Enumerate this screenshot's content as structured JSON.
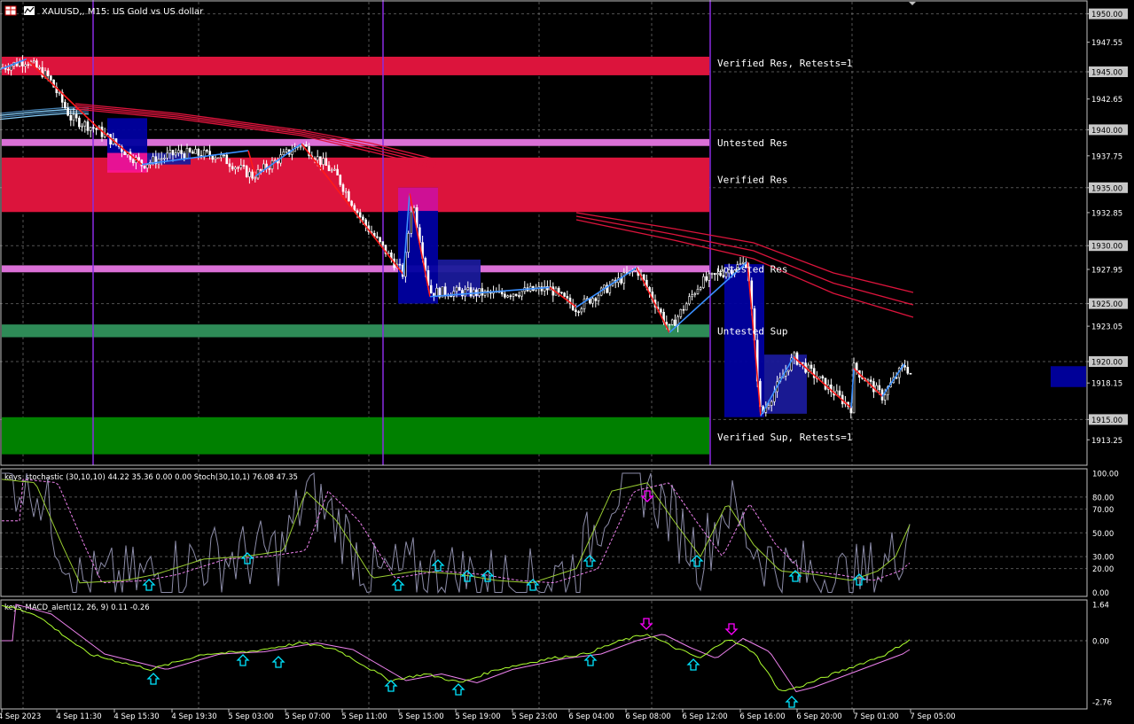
{
  "window": {
    "title": "XAUUSD,, M15: US Gold vs US dollar",
    "toolbar_icons": [
      "table-icon",
      "chart-icon"
    ]
  },
  "price_axis": {
    "labels": [
      "1950.00",
      "1947.55",
      "1945.00",
      "1942.65",
      "1940.00",
      "1937.75",
      "1935.00",
      "1932.85",
      "1930.00",
      "1927.95",
      "1925.00",
      "1923.05",
      "1920.00",
      "1918.15",
      "1915.00",
      "1913.25"
    ],
    "boxed": [
      "1950.00",
      "1945.00",
      "1940.00",
      "1935.00",
      "1930.00",
      "1925.00",
      "1920.00",
      "1915.00"
    ],
    "range": [
      1911,
      1951
    ]
  },
  "zones": [
    {
      "label": "Verified Res, Retests=1",
      "from": 1944.7,
      "to": 1946.3,
      "color": "#dc143c"
    },
    {
      "label": "Untested Res",
      "from": 1938.6,
      "to": 1939.2,
      "color": "#da70d6"
    },
    {
      "label": "Verified Res",
      "from": 1932.9,
      "to": 1937.6,
      "color": "#dc143c"
    },
    {
      "label": "Untested Res",
      "from": 1927.7,
      "to": 1928.3,
      "color": "#da70d6"
    },
    {
      "label": "Untested Sup",
      "from": 1922.1,
      "to": 1923.2,
      "color": "#2e8b57"
    },
    {
      "label": "Verified Sup, Retests=1",
      "from": 1912.0,
      "to": 1915.2,
      "color": "#008000"
    }
  ],
  "time_axis": {
    "labels": [
      "4 Sep 2023",
      "4 Sep 11:30",
      "4 Sep 15:30",
      "4 Sep 19:30",
      "5 Sep 03:00",
      "5 Sep 07:00",
      "5 Sep 11:00",
      "5 Sep 15:00",
      "5 Sep 19:00",
      "5 Sep 23:00",
      "6 Sep 04:00",
      "6 Sep 08:00",
      "6 Sep 12:00",
      "6 Sep 16:00",
      "6 Sep 20:00",
      "7 Sep 01:00",
      "7 Sep 05:00"
    ]
  },
  "stochastic": {
    "header": "keys_stochastic (30,10,10) 44.22 35.36 0.00 0.00 Stoch(30,10,1) 76.08 47.35",
    "levels": [
      "100.00",
      "80.00",
      "70.00",
      "50.00",
      "30.00",
      "20.00",
      "0.00"
    ]
  },
  "macd": {
    "header": "keys_MACD_alert(12, 26, 9) 0.11 -0.26",
    "levels": [
      "1.64",
      "0.00",
      "-2.76"
    ]
  },
  "colors": {
    "background": "#000000",
    "grid": "#8a8a8a",
    "zigzag_up": "#3a8fff",
    "zigzag_down": "#ff1a1a",
    "ma": "#dc143c",
    "session_line": "#8a2be2",
    "box": "#00008b",
    "arrow_up": "#00e5ff",
    "arrow_down": "#ff00ff"
  },
  "chart_data": {
    "type": "line",
    "x": [
      "4 Sep 2023",
      "4 Sep 11:30",
      "4 Sep 15:30",
      "4 Sep 19:30",
      "5 Sep 03:00",
      "5 Sep 07:00",
      "5 Sep 11:00",
      "5 Sep 15:00",
      "5 Sep 19:00",
      "5 Sep 23:00",
      "6 Sep 04:00",
      "6 Sep 08:00",
      "6 Sep 12:00",
      "6 Sep 16:00",
      "6 Sep 20:00",
      "7 Sep 01:00",
      "7 Sep 05:00"
    ],
    "series": [
      {
        "name": "XAUUSD,, M15",
        "values": [
          1945.5,
          1941.0,
          1937.5,
          1938.2,
          1937.0,
          1938.8,
          1932.5,
          1925.8,
          1926.0,
          1926.2,
          1924.7,
          1928.0,
          1923.5,
          1915.5,
          1918.5,
          1919.0,
          1918.8
        ]
      }
    ],
    "ylim": [
      1911,
      1951
    ]
  }
}
